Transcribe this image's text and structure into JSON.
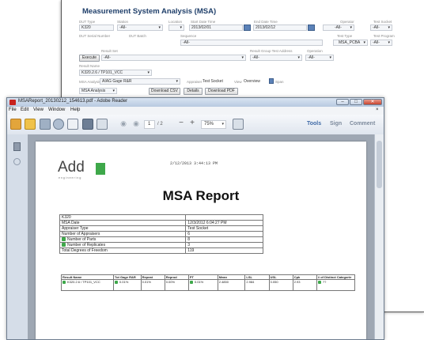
{
  "web": {
    "title": "Measurement System Analysis (MSA)",
    "row1": [
      {
        "label": "DUT Type",
        "value": "K320"
      },
      {
        "label": "Station",
        "value": "-All-"
      },
      {
        "label": "Location",
        "value": ""
      },
      {
        "label": "Start Date Time",
        "value": "2013/02/01"
      },
      {
        "label": "End Date Time",
        "value": "2013/02/12"
      },
      {
        "label": "Operator",
        "value": "-All-"
      },
      {
        "label": "Test Socket",
        "value": "-All-"
      }
    ],
    "row2": [
      {
        "label": "DUT Serial Number",
        "value": ""
      },
      {
        "label": "DUT Batch",
        "value": ""
      },
      {
        "label": "Sequence",
        "value": "-All-"
      },
      {
        "label": "Test Type",
        "value": "MSA_PCBA"
      },
      {
        "label": "Test Program",
        "value": "-All-"
      }
    ],
    "row3": {
      "button": "Execute",
      "labels": [
        "Result Set",
        "Result Group Test Address",
        "Operation"
      ],
      "values": [
        "-All-",
        "-All-",
        "-All-"
      ]
    },
    "result_name_label": "Result Name",
    "result_name_value": "K320.2.6 / TP101_VCC",
    "analysis": {
      "label": "MSA Analysis",
      "value": "AIAG Gage R&R",
      "appraiser_label": "Appraiser",
      "appraiser_value": "Test Socket",
      "view_label": "View",
      "view_value": "Overview",
      "span_label": "Span"
    },
    "bottom_buttons": [
      "MSA Analysis",
      "Download CSV",
      "Details",
      "Download PDF"
    ]
  },
  "reader": {
    "window_title": "MSAReport_20130212_154613.pdf - Adobe Reader",
    "menu": [
      "File",
      "Edit",
      "View",
      "Window",
      "Help"
    ],
    "page_current": "1",
    "page_total": "/ 2",
    "zoom": "75%",
    "toolbar_links": [
      "Tools",
      "Sign",
      "Comment"
    ]
  },
  "report": {
    "logo_text": "Add",
    "logo_sub": "engineering",
    "timestamp": "2/12/2013 3:44:13 PM",
    "title": "MSA Report",
    "info_rows": [
      {
        "plus": false,
        "label": "K320",
        "value": ""
      },
      {
        "plus": false,
        "label": "MSA Date",
        "value": "12/3/2012 6:04:27 PM"
      },
      {
        "plus": false,
        "label": "Appraiser Type",
        "value": "Test Socket"
      },
      {
        "plus": false,
        "label": "Number of Appraisers",
        "value": "6"
      },
      {
        "plus": true,
        "label": "Number of Parts",
        "value": "8"
      },
      {
        "plus": true,
        "label": "Number of Replicates",
        "value": "3"
      },
      {
        "plus": false,
        "label": "Total Degrees of Freedom",
        "value": "119"
      }
    ],
    "result_headers": [
      "Result Name",
      "Tot Gage R&R",
      "Repeat",
      "Reprod",
      "PT",
      "Mean",
      "LSL",
      "USL",
      "Cpk",
      "# of Distinct Categorie"
    ],
    "result_row": [
      "K320.2.6 / TP101_VCC",
      "0.01%",
      "0.01%",
      "0.00%",
      "0.01%",
      "2.4850",
      "2.984",
      "3.050",
      "2.93",
      "??"
    ]
  },
  "colors": {
    "accent": "#3f6aa6",
    "logo_green": "#3ea84a",
    "title_blue": "#1f3f6a"
  }
}
